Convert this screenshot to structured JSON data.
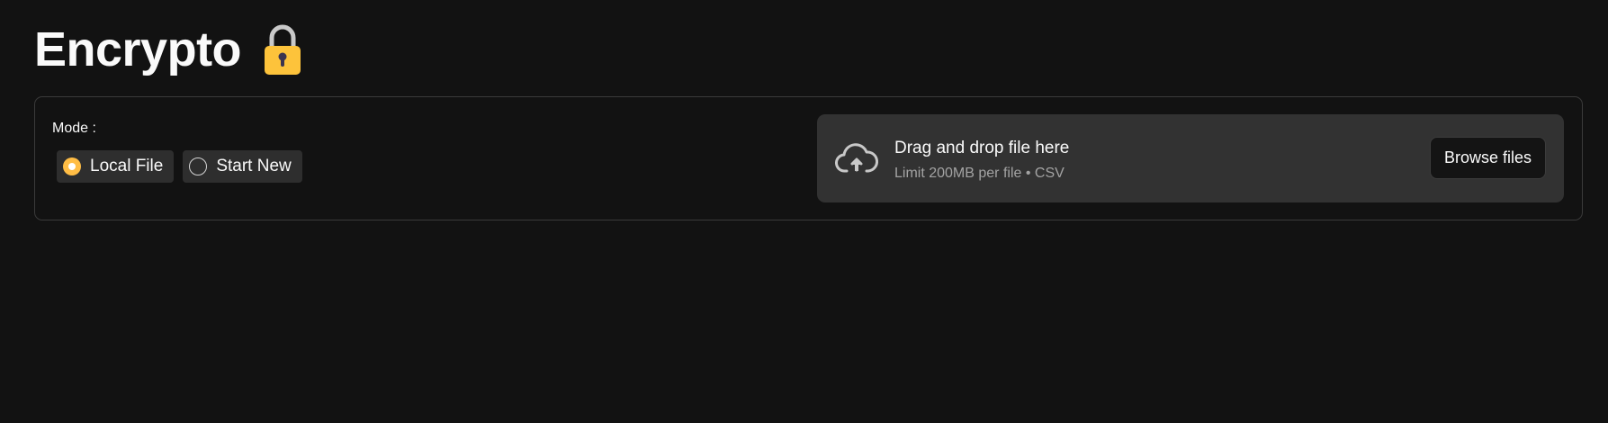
{
  "app": {
    "title": "Encrypto",
    "title_icon": "lock-icon"
  },
  "mode": {
    "label": "Mode :",
    "options": [
      {
        "label": "Local File",
        "selected": true
      },
      {
        "label": "Start New",
        "selected": false
      }
    ],
    "accent_color": "#ffbd45"
  },
  "uploader": {
    "icon": "cloud-upload-icon",
    "title": "Drag and drop file here",
    "subtitle": "Limit 200MB per file • CSV",
    "button_label": "Browse files"
  }
}
